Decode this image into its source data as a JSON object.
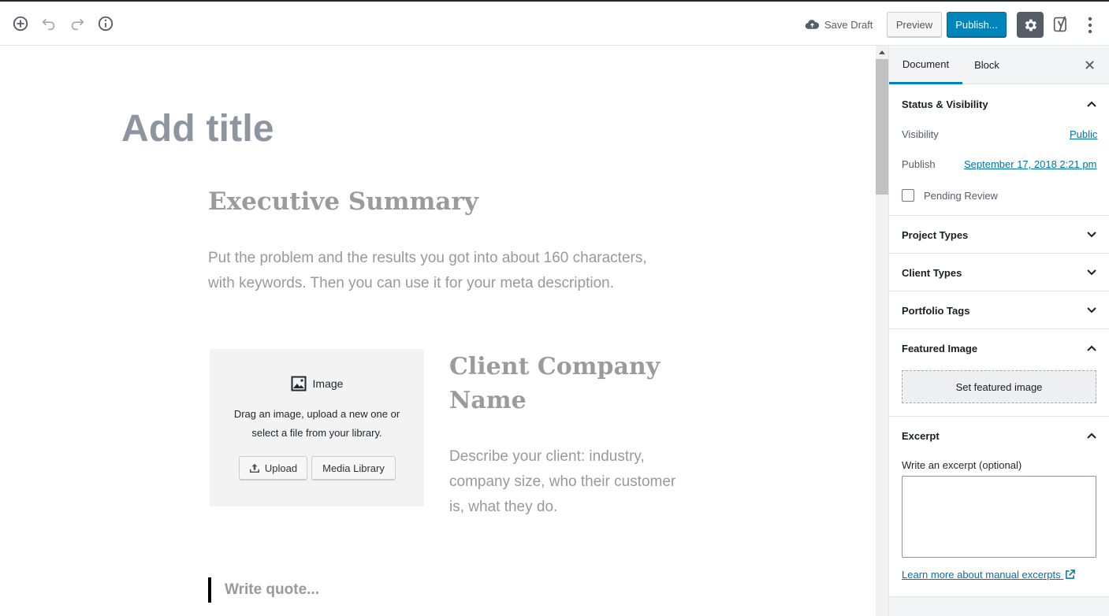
{
  "toolbar": {
    "save_draft": "Save Draft",
    "preview": "Preview",
    "publish": "Publish...",
    "icons": [
      "add-block-icon",
      "undo-icon",
      "redo-icon",
      "info-icon",
      "cloud-icon",
      "gear-icon",
      "yoast-icon",
      "more-vertical-icon"
    ]
  },
  "editor": {
    "title_placeholder": "Add title",
    "heading_exec": "Executive Summary",
    "para_exec": "Put the problem and the results you got into about 160 characters, with keywords. Then you can use it for your meta description.",
    "image_block": {
      "label": "Image",
      "description": "Drag an image, upload a new one or select a file from your library.",
      "upload": "Upload",
      "media_library": "Media Library"
    },
    "heading_client": "Client Company Name",
    "para_client": "Describe your client: industry, company size, who their customer is, what they do.",
    "quote_placeholder": "Write quote..."
  },
  "sidebar": {
    "tabs": [
      "Document",
      "Block"
    ],
    "active_tab": "Document",
    "status": {
      "title": "Status & Visibility",
      "visibility_label": "Visibility",
      "visibility_value": "Public",
      "publish_label": "Publish",
      "publish_value": "September 17, 2018 2:21 pm",
      "pending_review": "Pending Review"
    },
    "panels": [
      "Project Types",
      "Client Types",
      "Portfolio Tags"
    ],
    "featured_image": {
      "title": "Featured Image",
      "button": "Set featured image"
    },
    "excerpt": {
      "title": "Excerpt",
      "label": "Write an excerpt (optional)",
      "value": "",
      "learn_more": "Learn more about manual excerpts"
    }
  },
  "colors": {
    "accent": "#0085ba",
    "link": "#0073aa",
    "settings_bg": "#555d66"
  }
}
